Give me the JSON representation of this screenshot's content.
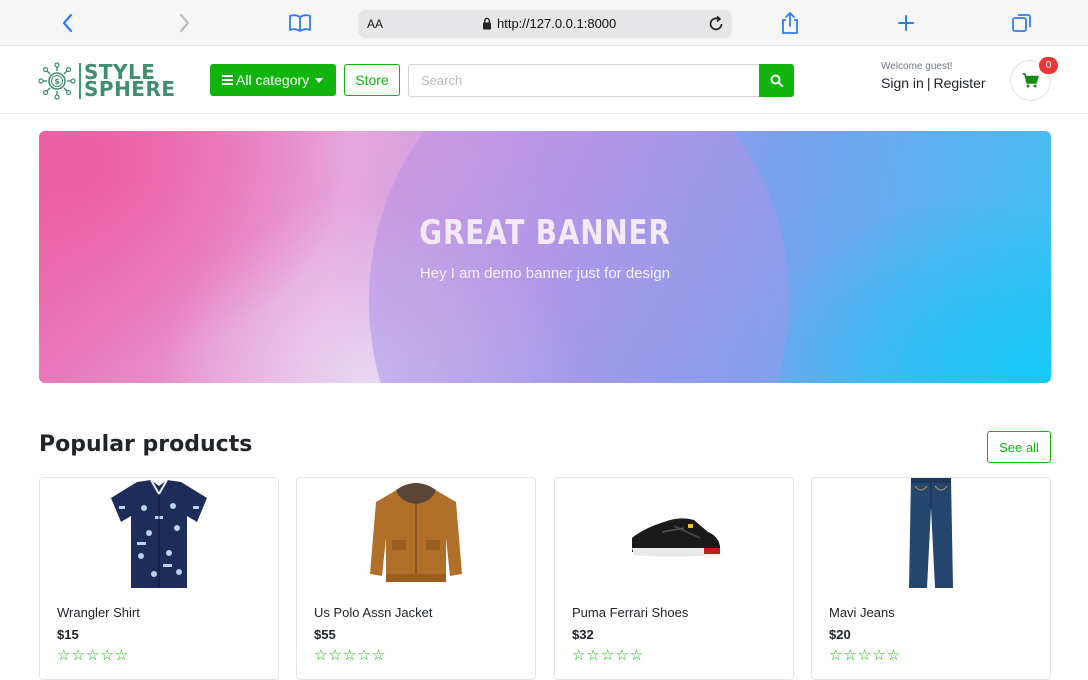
{
  "browser": {
    "text_size_label": "AA",
    "url": "http://127.0.0.1:8000"
  },
  "brand": {
    "line1": "STYLE",
    "line2": "SPHERE",
    "color": "#3f8f6c"
  },
  "navbar": {
    "category_label": "All category",
    "store_label": "Store",
    "search_placeholder": "Search",
    "welcome": "Welcome guest!",
    "sign_in": "Sign in",
    "separator": "|",
    "register": "Register",
    "cart_count": "0"
  },
  "banner": {
    "title": "GREAT BANNER",
    "subtitle": "Hey I am demo banner just for design"
  },
  "popular": {
    "title": "Popular products",
    "see_all": "See all",
    "products": [
      {
        "name": "Wrangler Shirt",
        "price": "$15",
        "stars": "☆☆☆☆☆",
        "image": "shirt-image"
      },
      {
        "name": "Us Polo Assn Jacket",
        "price": "$55",
        "stars": "☆☆☆☆☆",
        "image": "jacket-image"
      },
      {
        "name": "Puma Ferrari Shoes",
        "price": "$32",
        "stars": "☆☆☆☆☆",
        "image": "shoes-image"
      },
      {
        "name": "Mavi Jeans",
        "price": "$20",
        "stars": "☆☆☆☆☆",
        "image": "jeans-image"
      }
    ]
  },
  "colors": {
    "accent": "#12b40e",
    "badge": "#e93535"
  }
}
